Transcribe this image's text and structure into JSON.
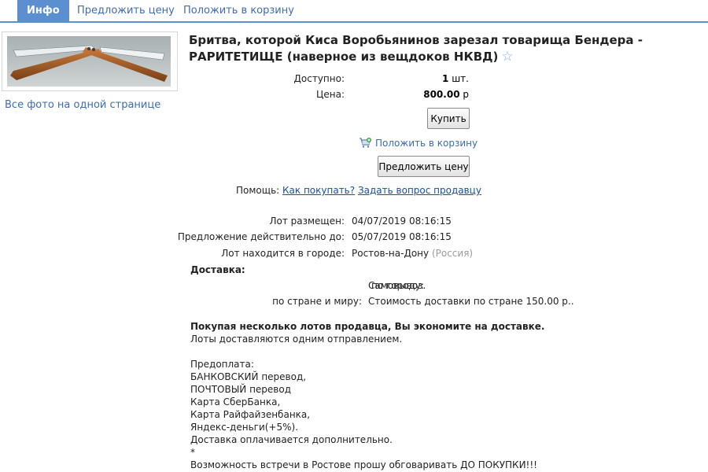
{
  "tabs": [
    {
      "label": "Инфо"
    },
    {
      "label": "Предложить цену"
    },
    {
      "label": "Положить в корзину"
    }
  ],
  "gallery": {
    "all_photos": "Все фото на одной странице"
  },
  "lot": {
    "title": "Бритва, которой Киса Воробьянинов зарезал товарища Бендера - РАРИТЕТИЩЕ (наверное из вещдоков НКВД)",
    "star": "☆"
  },
  "purchase": {
    "available_label": "Доступно:",
    "available_value": "1",
    "available_unit": "шт.",
    "price_label": "Цена:",
    "price_value": "800.00",
    "price_currency": "р",
    "buy_button": "Купить",
    "add_to_cart": "Положить в корзину",
    "offer_button": "Предложить цену",
    "help_label": "Помощь:",
    "help_how": "Как покупать?",
    "help_ask": "Задать вопрос продавцу"
  },
  "details": {
    "placed_label": "Лот размещен:",
    "placed_value": "04/07/2019 08:16:15",
    "valid_label": "Предложение действительно до:",
    "valid_value": "05/07/2019 08:16:15",
    "city_label": "Лот находится в городе:",
    "city_value": "Ростов-на-Дону",
    "country": "(Россия)"
  },
  "delivery": {
    "heading": "Доставка:",
    "city_label": "по городу:",
    "city_value": "Самовывоз.",
    "world_label": "по стране и миру:",
    "world_value": "Стоимость доставки по стране 150.00 р.."
  },
  "description": {
    "save_heading": "Покупая несколько лотов продавца, Вы экономите на доставке.",
    "lines": [
      "Лоты доставляются одним отправлением.",
      "",
      "Предоплата:",
      "БАНКОВСКИЙ перевод,",
      "ПОЧТОВЫЙ перевод",
      "Карта СберБанка,",
      "Карта Райфайзенбанка,",
      "Яндекс-деньги(+5%).",
      "Доставка оплачивается дополнительно.",
      "*",
      "Возможность встречи в Ростове прошу обговаривать ДО ПОКУПКИ!!!"
    ]
  },
  "colors": {
    "accent": "#5b8fd0",
    "link": "#1a4fa0"
  }
}
